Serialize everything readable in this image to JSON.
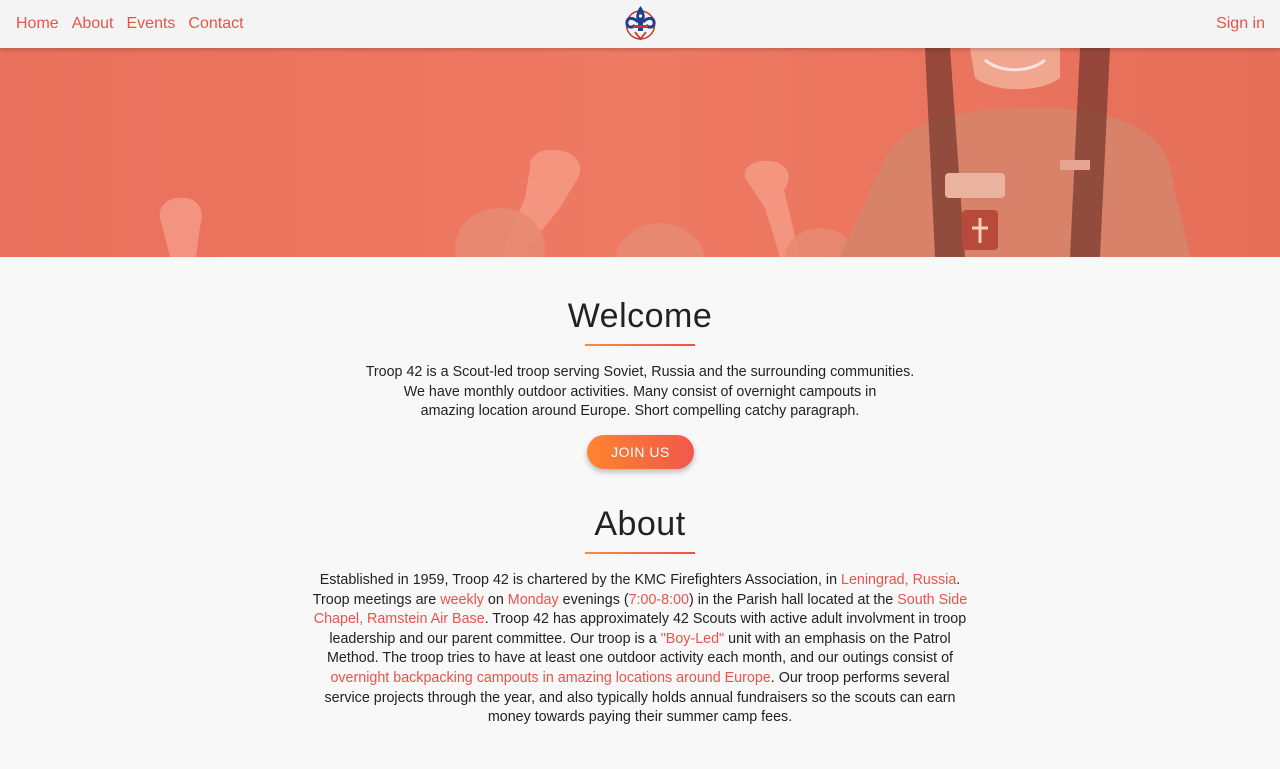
{
  "nav": {
    "home": "Home",
    "about": "About",
    "events": "Events",
    "contact": "Contact",
    "signin": "Sign in"
  },
  "welcome": {
    "title": "Welcome",
    "line1": "Troop 42 is a Scout-led troop serving Soviet, Russia and the surrounding communities.",
    "line2": "We have monthly outdoor activities. Many consist of overnight campouts in",
    "line3": "amazing location around Europe. Short compelling catchy paragraph.",
    "button": "JOIN US"
  },
  "about": {
    "title": "About",
    "t1": "Established in 1959, Troop 42 is chartered by the KMC Firefighters Association, in ",
    "link_location": "Leningrad, Russia",
    "t2": ". Troop meetings are ",
    "link_weekly": "weekly",
    "t3": " on ",
    "link_monday": "Monday",
    "t4": " evenings (",
    "link_time": "7:00-8:00",
    "t5": ") in the Parish hall located at the ",
    "link_chapel": "South Side Chapel, Ramstein Air Base",
    "t6": ". Troop 42 has approximately 42 Scouts with active adult involvment in troop leadership and our parent committee. Our troop is a ",
    "link_boyled": "\"Boy-Led\"",
    "t7": " unit with an emphasis on the Patrol Method. The troop tries to have at least one outdoor activity each month, and our outings consist of ",
    "link_outings": "overnight backpacking campouts in amazing locations around Europe",
    "t8": ". Our troop performs several service projects through the year, and also typically holds annual fundraisers so the scouts can earn money towards paying their summer camp fees."
  },
  "colors": {
    "accent": "#e8544a",
    "gradient_start": "#ff8430",
    "gradient_end": "#f0584a",
    "hero_overlay": "#ee7660"
  },
  "icons": {
    "logo": "scout-fleur-de-lis-logo"
  }
}
